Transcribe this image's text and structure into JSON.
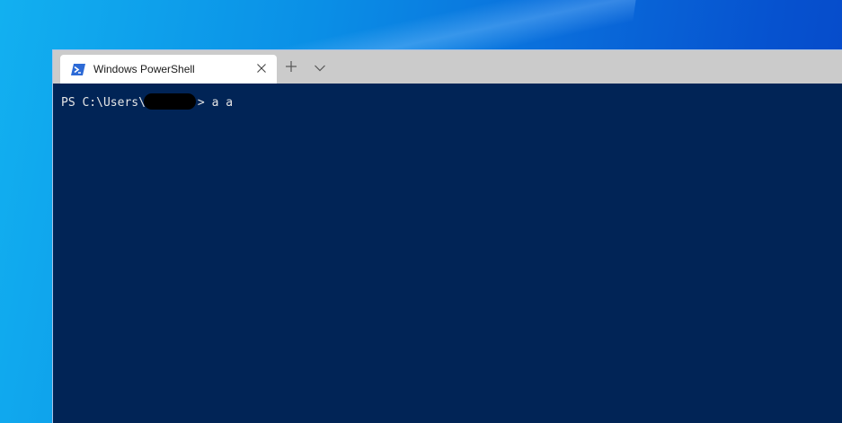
{
  "window": {
    "tab_title": "Windows PowerShell",
    "tab_icon": "powershell-icon",
    "close_icon": "close-icon",
    "new_tab_icon": "plus-icon",
    "dropdown_icon": "chevron-down-icon"
  },
  "terminal": {
    "prompt_prefix": "PS C:\\Users\\",
    "prompt_suffix": ">",
    "command": " a a",
    "background": "#012456",
    "text_color": "#e6e6e6"
  },
  "colors": {
    "tab_bar": "#cbcbcb",
    "tab_active": "#ffffff",
    "powershell_icon": "#2d6ad6"
  }
}
